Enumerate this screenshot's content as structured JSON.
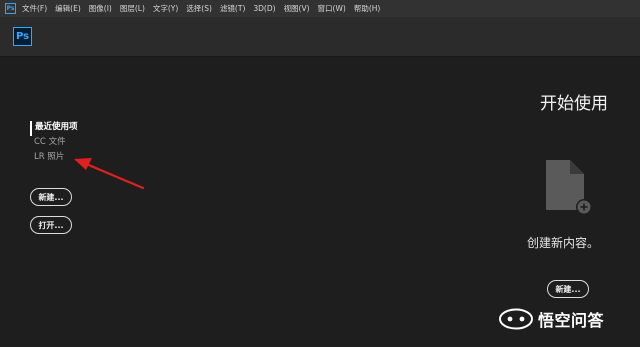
{
  "menubar": {
    "app_icon": "Ps",
    "items": [
      "文件(F)",
      "编辑(E)",
      "图像(I)",
      "图层(L)",
      "文字(Y)",
      "选择(S)",
      "滤镜(T)",
      "3D(D)",
      "视图(V)",
      "窗口(W)",
      "帮助(H)"
    ]
  },
  "toolbar": {
    "logo": "Ps"
  },
  "left_nav": {
    "items": [
      "最近使用项",
      "CC 文件",
      "LR 照片"
    ],
    "new_button": "新建...",
    "open_button": "打开..."
  },
  "right_panel": {
    "title": "开始使用",
    "create_label": "创建新内容。",
    "new_button": "新建..."
  },
  "watermark": {
    "text": "悟空问答"
  },
  "colors": {
    "accent": "#31a8ff",
    "annotation_arrow": "#e02020"
  },
  "icons": {
    "document": "document-plus-icon",
    "watermark": "wukong-logo-icon"
  }
}
